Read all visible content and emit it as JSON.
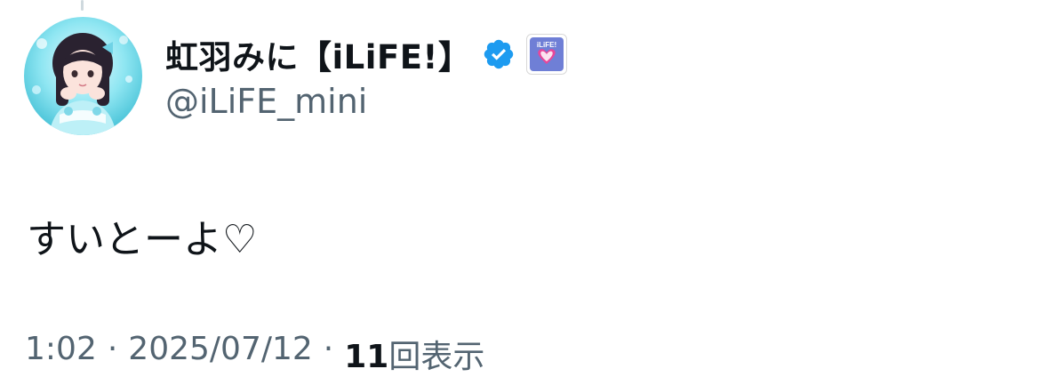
{
  "colors": {
    "text_primary": "#0f1419",
    "text_secondary": "#536471",
    "verified_blue": "#1d9bf0",
    "avatar_accent": "#4fc6da",
    "badge_accent": "#e8479a"
  },
  "author": {
    "display_name": "虹羽みに【iLiFE!】",
    "handle": "@iLiFE_mini",
    "verified_icon": "verified-badge-icon",
    "affiliate_badge_icon": "ilife-affiliate-logo-icon",
    "affiliate_badge_text": "iLiFE!",
    "avatar_icon": "profile-avatar"
  },
  "tweet": {
    "text": "すいとーよ♡"
  },
  "meta": {
    "time": "1:02",
    "separator": "·",
    "date": "2025/07/12",
    "separator2": "·",
    "views_count": "11",
    "views_label": "回表示"
  }
}
